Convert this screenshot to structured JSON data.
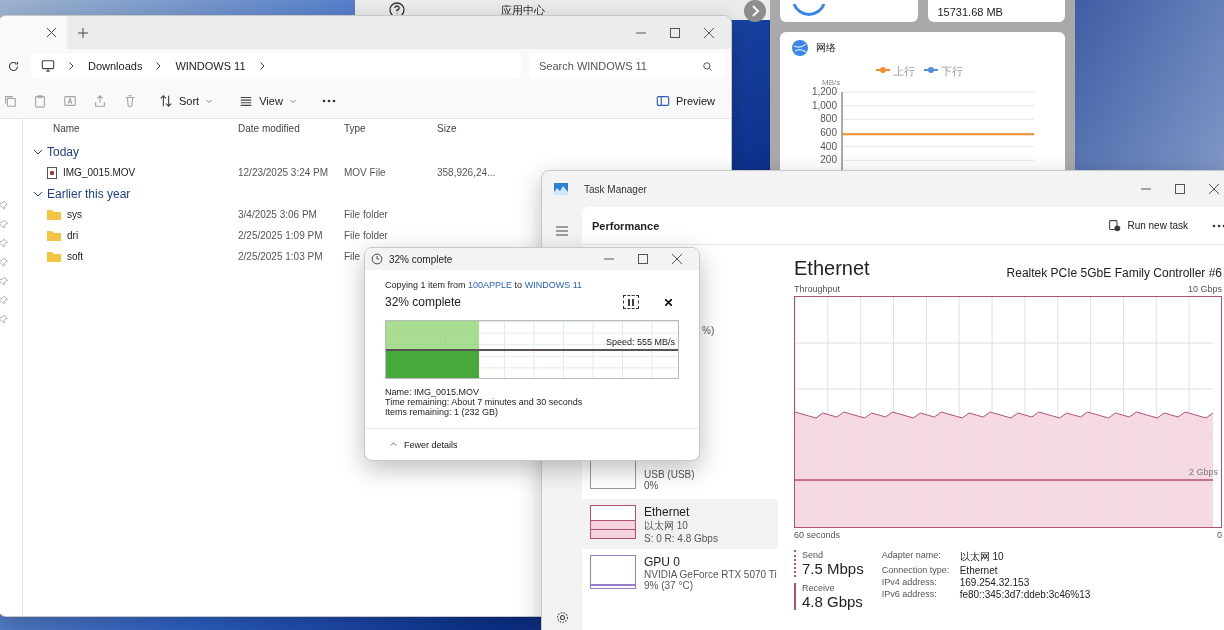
{
  "background_app": {
    "title": "应用中心",
    "memory_card": {
      "value": "15731.68 MB"
    },
    "network_card": {
      "title": "网络",
      "chart_data": {
        "type": "line",
        "ylabel": "MB/s",
        "grid": true,
        "ylim": [
          0,
          1200
        ],
        "yticks": [
          {
            "value": 200,
            "label": "200"
          },
          {
            "value": 400,
            "label": "400"
          },
          {
            "value": 600,
            "label": "600"
          },
          {
            "value": 800,
            "label": "800"
          },
          {
            "value": 1000,
            "label": "1,000"
          },
          {
            "value": 1200,
            "label": "1,200"
          }
        ],
        "series": [
          {
            "name": "上行",
            "color": "#f28e2b",
            "values": [
              580,
              580,
              580,
              580,
              580,
              580,
              580,
              580,
              580,
              580
            ]
          },
          {
            "name": "下行",
            "color": "#4a90e2",
            "values": [
              null,
              null,
              null,
              null,
              null,
              null,
              null,
              null,
              null,
              null
            ]
          }
        ]
      }
    }
  },
  "explorer": {
    "breadcrumb": [
      "Downloads",
      "WINDOWS 11"
    ],
    "search": {
      "placeholder": "Search WINDOWS 11"
    },
    "toolbar": {
      "sort": "Sort",
      "view": "View",
      "preview": "Preview"
    },
    "columns": [
      "Name",
      "Date modified",
      "Type",
      "Size"
    ],
    "groups": [
      {
        "label": "Today",
        "expanded": true,
        "rows": [
          {
            "kind": "video",
            "name": "IMG_0015.MOV",
            "date": "12/23/2025 3:24 PM",
            "type": "MOV File",
            "size": "358,926,24..."
          }
        ]
      },
      {
        "label": "Earlier this year",
        "expanded": true,
        "rows": [
          {
            "kind": "folder",
            "name": "sys",
            "date": "3/4/2025 3:06 PM",
            "type": "File folder"
          },
          {
            "kind": "folder",
            "name": "dri",
            "date": "2/25/2025 1:09 PM",
            "type": "File folder"
          },
          {
            "kind": "folder",
            "name": "soft",
            "date": "2/25/2025 1:03 PM",
            "type": "File"
          }
        ]
      }
    ]
  },
  "task_manager": {
    "title": "Task Manager",
    "page": "Performance",
    "run_new_task": "Run new task",
    "devices": [
      {
        "kind": "clipped",
        "details": [
          "%)"
        ],
        "selected": false
      },
      {
        "kind": "disk",
        "details": [
          "USB (USB)",
          "0%"
        ],
        "selected": false
      },
      {
        "kind": "network",
        "name": "Ethernet",
        "details": [
          "以太网 10",
          "S: 0 R: 4.8 Gbps"
        ],
        "selected": true
      },
      {
        "kind": "gpu",
        "name": "GPU 0",
        "details": [
          "NVIDIA GeForce RTX 5070 Ti",
          "9%  (37 °C)"
        ],
        "selected": false
      }
    ],
    "heading": "Ethernet",
    "adapter": "Realtek PCIe 5GbE Family Controller #6",
    "graph_label": "Throughput",
    "graph_max": "10 Gbps",
    "graph_marker": "2 Gbps",
    "graph_time": "60 seconds",
    "graph_min": "0",
    "rates": [
      {
        "label": "Send",
        "value": "7.5 Mbps"
      },
      {
        "label": "Receive",
        "value": "4.8 Gbps"
      }
    ],
    "properties": [
      {
        "label": "Adapter name:",
        "value": "以太网 10"
      },
      {
        "label": "Connection type:",
        "value": "Ethernet"
      },
      {
        "label": "IPv4 address:",
        "value": "169.254.32.153"
      },
      {
        "label": "IPv6 address:",
        "value": "fe80::345:3d7:ddeb:3c46%13"
      }
    ]
  },
  "copy_dialog": {
    "title": "32% complete",
    "message": [
      "Copying 1 item from",
      "100APPLE",
      "to",
      "WINDOWS 11"
    ],
    "heading": "32% complete",
    "progress": {
      "level": 0.32,
      "speed": "Speed: 555 MB/s"
    },
    "details": [
      "Name:  IMG_0015.MOV",
      "Time remaining:  About 7 minutes and 30 seconds",
      "Items remaining:  1 (232 GB)"
    ],
    "toggle": "Fewer details"
  }
}
